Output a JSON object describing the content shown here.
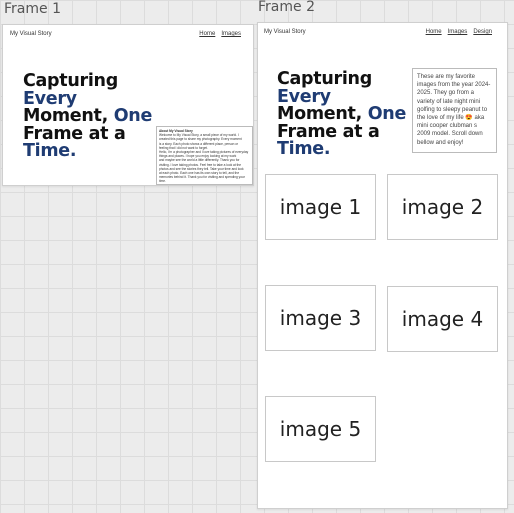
{
  "canvas": {
    "frame1_label": "Frame 1",
    "frame2_label": "Frame 2"
  },
  "frame1": {
    "site_title": "My Visual Story",
    "nav": [
      "Home",
      "Images"
    ],
    "headline": {
      "l1": "Capturing",
      "l2": "Every",
      "l3a": "Moment, ",
      "l3b": "One",
      "l4": "Frame at a",
      "l5": "Time."
    },
    "about_title": "About My Visual Story",
    "about_lines": [
      "Welcome to My Visual Story, a small piece of my world. I",
      "created this page to share my photography. Every moment",
      "is a story. Each photo shows a different place, person or",
      "feeling that I did not want to forget.",
      "Hello, I'm a photographer and I love taking pictures of everyday",
      "things and places. I hope you enjoy looking at my work",
      "and maybe see the world a little differently. Thank you for",
      "visiting. I love taking photos. Feel free to take a look at the",
      "photos and see the stories they tell. Take your time and look",
      "at each photo. Each one has its own story to tell, and the",
      "memories behind it. Thank you for visiting and spending your time."
    ]
  },
  "frame2": {
    "site_title": "My Visual Story",
    "nav": [
      "Home",
      "Images",
      "Design"
    ],
    "headline": {
      "l1": "Capturing",
      "l2": "Every",
      "l3a": "Moment, ",
      "l3b": "One",
      "l4": "Frame at a",
      "l5": "Time."
    },
    "description": "These are my favorite images from the year 2024-2025. They go from a variety of late night mini golfing to sleepy peanut to the love of my life 😍 aka mini cooper clubman s 2009 model. Scroll down bellow and enjoy!",
    "images": [
      "image 1",
      "image 2",
      "image 3",
      "image 4",
      "image 5"
    ]
  },
  "colors": {
    "accent_blue": "#1f3c73",
    "canvas_bg": "#ececec"
  }
}
